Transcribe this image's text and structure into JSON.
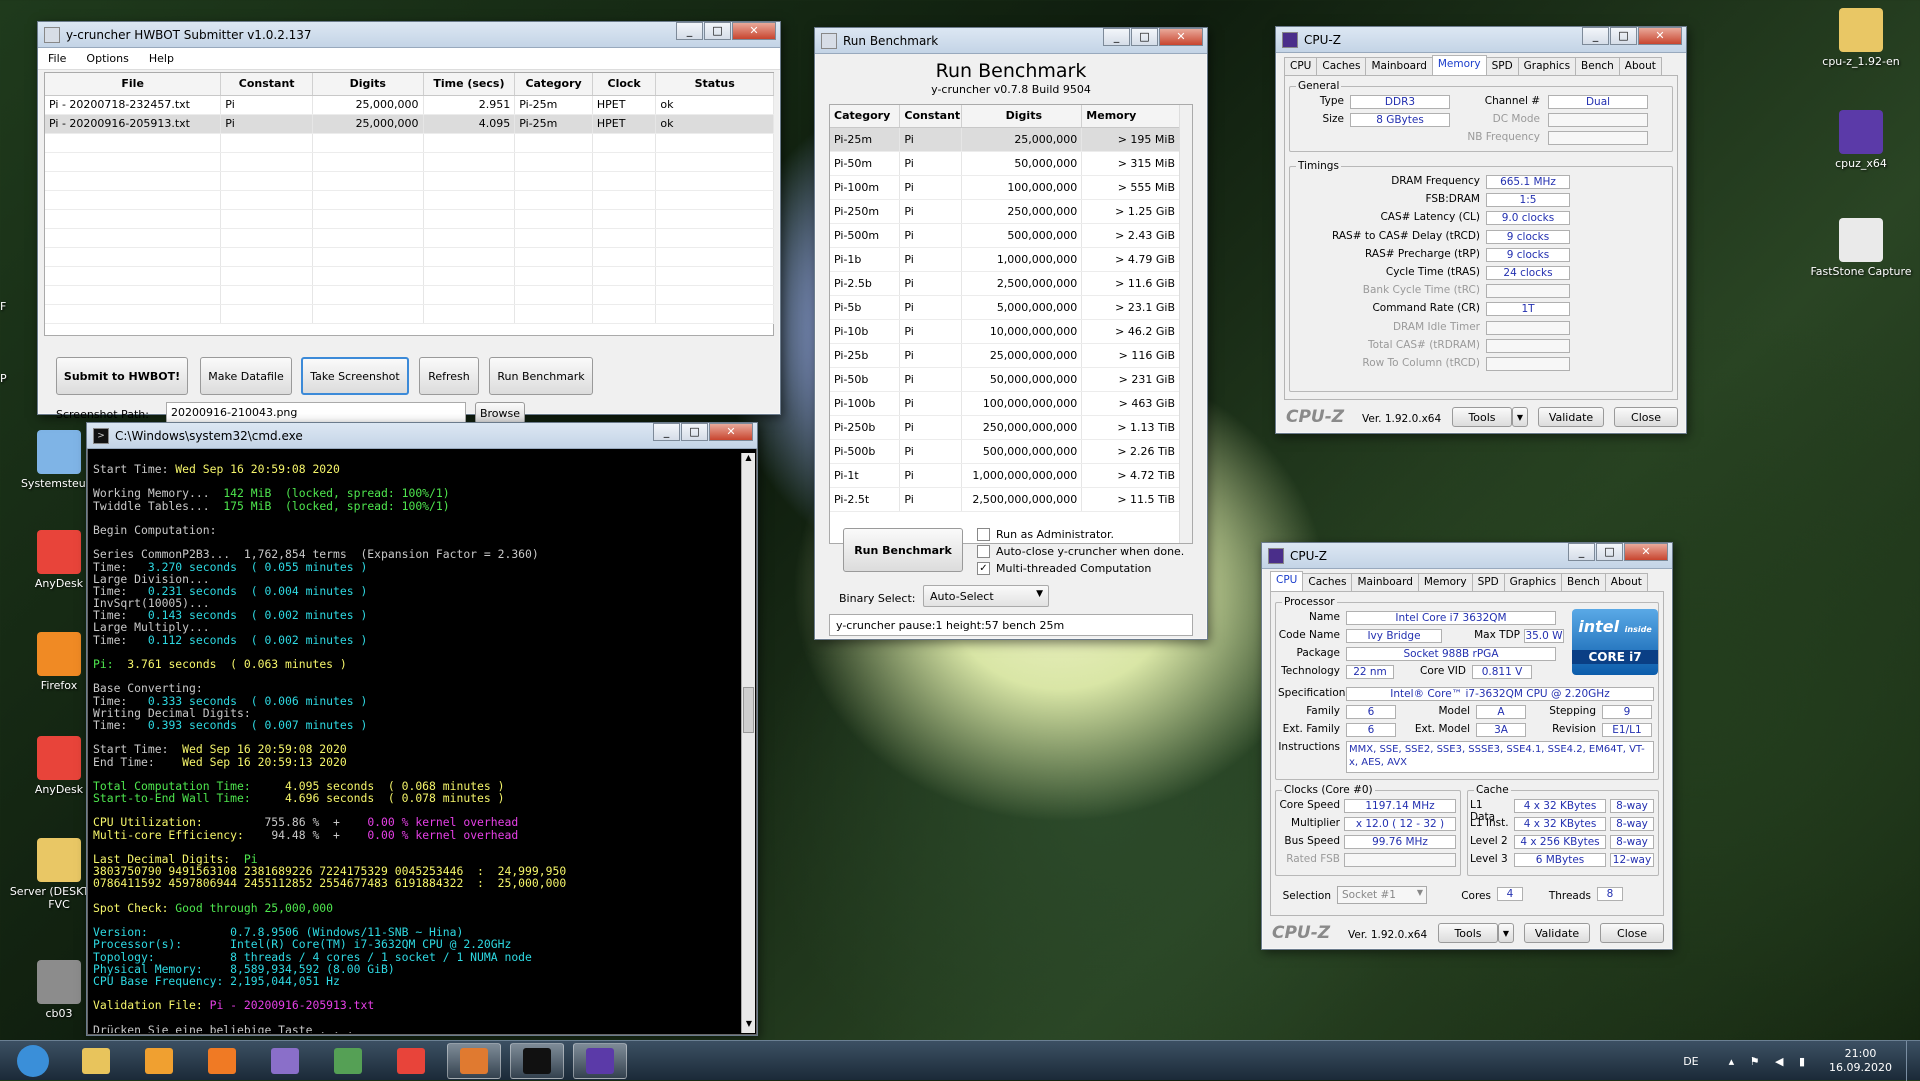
{
  "desktop": {
    "icons_left": [
      {
        "label": "Systemsteuer",
        "icon": "control-panel-icon"
      },
      {
        "label": "AnyDesk",
        "icon": "anydesk-icon"
      },
      {
        "label": "Firefox",
        "icon": "firefox-icon"
      },
      {
        "label": "AnyDesk",
        "icon": "anydesk-icon"
      },
      {
        "label": "Server (DESKTOP-FVC",
        "icon": "server-folder-icon"
      },
      {
        "label": "cb03",
        "icon": "image-file-icon"
      }
    ],
    "icons_right": [
      {
        "label": "cpu-z_1.92-en",
        "icon": "folder-zip-icon"
      },
      {
        "label": "cpuz_x64",
        "icon": "cpuz-icon"
      },
      {
        "label": "FastStone Capture",
        "icon": "faststone-icon"
      }
    ],
    "edge_letters": [
      "F",
      "P"
    ]
  },
  "submitter": {
    "title": "y-cruncher HWBOT Submitter v1.0.2.137",
    "menu": [
      "File",
      "Options",
      "Help"
    ],
    "columns": [
      "File",
      "Constant",
      "Digits",
      "Time (secs)",
      "Category",
      "Clock",
      "Status"
    ],
    "rows": [
      [
        "Pi - 20200718-232457.txt",
        "Pi",
        "25,000,000",
        "2.951",
        "Pi-25m",
        "HPET",
        "ok"
      ],
      [
        "Pi - 20200916-205913.txt",
        "Pi",
        "25,000,000",
        "4.095",
        "Pi-25m",
        "HPET",
        "ok"
      ]
    ],
    "buttons": [
      "Submit to HWBOT!",
      "Make Datafile",
      "Take Screenshot",
      "Refresh",
      "Run Benchmark"
    ],
    "screenshot_label": "Screenshot Path:",
    "screenshot_value": "20200916-210043.png",
    "browse": "Browse"
  },
  "bench": {
    "window_title": "Run Benchmark",
    "heading": "Run Benchmark",
    "subheading": "y-cruncher v0.7.8 Build 9504",
    "columns": [
      "Category",
      "Constant",
      "Digits",
      "Memory"
    ],
    "rows": [
      [
        "Pi-25m",
        "Pi",
        "25,000,000",
        "> 195 MiB"
      ],
      [
        "Pi-50m",
        "Pi",
        "50,000,000",
        "> 315 MiB"
      ],
      [
        "Pi-100m",
        "Pi",
        "100,000,000",
        "> 555 MiB"
      ],
      [
        "Pi-250m",
        "Pi",
        "250,000,000",
        "> 1.25 GiB"
      ],
      [
        "Pi-500m",
        "Pi",
        "500,000,000",
        "> 2.43 GiB"
      ],
      [
        "Pi-1b",
        "Pi",
        "1,000,000,000",
        "> 4.79 GiB"
      ],
      [
        "Pi-2.5b",
        "Pi",
        "2,500,000,000",
        "> 11.6 GiB"
      ],
      [
        "Pi-5b",
        "Pi",
        "5,000,000,000",
        "> 23.1 GiB"
      ],
      [
        "Pi-10b",
        "Pi",
        "10,000,000,000",
        "> 46.2 GiB"
      ],
      [
        "Pi-25b",
        "Pi",
        "25,000,000,000",
        "> 116 GiB"
      ],
      [
        "Pi-50b",
        "Pi",
        "50,000,000,000",
        "> 231 GiB"
      ],
      [
        "Pi-100b",
        "Pi",
        "100,000,000,000",
        "> 463 GiB"
      ],
      [
        "Pi-250b",
        "Pi",
        "250,000,000,000",
        "> 1.13 TiB"
      ],
      [
        "Pi-500b",
        "Pi",
        "500,000,000,000",
        "> 2.26 TiB"
      ],
      [
        "Pi-1t",
        "Pi",
        "1,000,000,000,000",
        "> 4.72 TiB"
      ],
      [
        "Pi-2.5t",
        "Pi",
        "2,500,000,000,000",
        "> 11.5 TiB"
      ]
    ],
    "run_button": "Run Benchmark",
    "checks": [
      {
        "label": "Run as Administrator.",
        "checked": false
      },
      {
        "label": "Auto-close y-cruncher when done.",
        "checked": false
      },
      {
        "label": "Multi-threaded Computation",
        "checked": true
      }
    ],
    "binary_label": "Binary Select:",
    "binary_value": "Auto-Select",
    "command": "y-cruncher pause:1 height:57 bench 25m"
  },
  "cmd": {
    "title": "C:\\Windows\\system32\\cmd.exe",
    "lines": [
      [
        [
          "Start Time: ",
          "cw"
        ],
        [
          "Wed Sep 16 20:59:08 2020",
          "cy"
        ]
      ],
      [
        [
          "",
          ""
        ]
      ],
      [
        [
          "Working Memory...  ",
          "cw"
        ],
        [
          "142 MiB  (locked, spread: 100%/1)",
          "cg"
        ]
      ],
      [
        [
          "Twiddle Tables...  ",
          "cw"
        ],
        [
          "175 MiB  (locked, spread: 100%/1)",
          "cg"
        ]
      ],
      [
        [
          "",
          ""
        ]
      ],
      [
        [
          "Begin Computation:",
          "cw"
        ]
      ],
      [
        [
          "",
          ""
        ]
      ],
      [
        [
          "Series CommonP2B3...  1,762,854 terms  (Expansion Factor = 2.360)",
          "cw"
        ]
      ],
      [
        [
          "Time:   ",
          "cw"
        ],
        [
          "3.270 seconds  ( 0.055 minutes )",
          "cc"
        ]
      ],
      [
        [
          "Large Division...",
          "cw"
        ]
      ],
      [
        [
          "Time:   ",
          "cw"
        ],
        [
          "0.231 seconds  ( 0.004 minutes )",
          "cc"
        ]
      ],
      [
        [
          "InvSqrt(10005)...",
          "cw"
        ]
      ],
      [
        [
          "Time:   ",
          "cw"
        ],
        [
          "0.143 seconds  ( 0.002 minutes )",
          "cc"
        ]
      ],
      [
        [
          "Large Multiply...",
          "cw"
        ]
      ],
      [
        [
          "Time:   ",
          "cw"
        ],
        [
          "0.112 seconds  ( 0.002 minutes )",
          "cc"
        ]
      ],
      [
        [
          "",
          ""
        ]
      ],
      [
        [
          "Pi:  ",
          "cg"
        ],
        [
          "3.761 seconds  ( 0.063 minutes )",
          "cy"
        ]
      ],
      [
        [
          "",
          ""
        ]
      ],
      [
        [
          "Base Converting:",
          "cw"
        ]
      ],
      [
        [
          "Time:   ",
          "cw"
        ],
        [
          "0.333 seconds  ( 0.006 minutes )",
          "cc"
        ]
      ],
      [
        [
          "Writing Decimal Digits:",
          "cw"
        ]
      ],
      [
        [
          "Time:   ",
          "cw"
        ],
        [
          "0.393 seconds  ( 0.007 minutes )",
          "cc"
        ]
      ],
      [
        [
          "",
          ""
        ]
      ],
      [
        [
          "Start Time:  ",
          "cw"
        ],
        [
          "Wed Sep 16 20:59:08 2020",
          "cy"
        ]
      ],
      [
        [
          "End Time:    ",
          "cw"
        ],
        [
          "Wed Sep 16 20:59:13 2020",
          "cy"
        ]
      ],
      [
        [
          "",
          ""
        ]
      ],
      [
        [
          "Total Computation Time:     ",
          "cg"
        ],
        [
          "4.095 seconds  ( 0.068 minutes )",
          "cy"
        ]
      ],
      [
        [
          "Start-to-End Wall Time:     ",
          "cg"
        ],
        [
          "4.696 seconds  ( 0.078 minutes )",
          "cy"
        ]
      ],
      [
        [
          "",
          ""
        ]
      ],
      [
        [
          "CPU Utilization:         ",
          "cy"
        ],
        [
          "755.86 %  +    ",
          "cw"
        ],
        [
          "0.00 % kernel overhead",
          "cm"
        ]
      ],
      [
        [
          "Multi-core Efficiency:    ",
          "cy"
        ],
        [
          "94.48 %  +    ",
          "cw"
        ],
        [
          "0.00 % kernel overhead",
          "cm"
        ]
      ],
      [
        [
          "",
          ""
        ]
      ],
      [
        [
          "Last Decimal Digits:  ",
          "cy"
        ],
        [
          "Pi",
          "cg"
        ]
      ],
      [
        [
          "3803750790 9491563108 2381689226 7224175329 0045253446  :  ",
          "cy"
        ],
        [
          "24,999,950",
          "cy"
        ]
      ],
      [
        [
          "0786411592 4597806944 2455112852 2554677483 6191884322  :  ",
          "cy"
        ],
        [
          "25,000,000",
          "cy"
        ]
      ],
      [
        [
          "",
          ""
        ]
      ],
      [
        [
          "Spot Check: ",
          "cy"
        ],
        [
          "Good through 25,000,000",
          "cg"
        ]
      ],
      [
        [
          "",
          ""
        ]
      ],
      [
        [
          "Version:            0.7.8.9506 (Windows/11-SNB ~ Hina)",
          "cc"
        ]
      ],
      [
        [
          "Processor(s):       Intel(R) Core(TM) i7-3632QM CPU @ 2.20GHz",
          "cc"
        ]
      ],
      [
        [
          "Topology:           8 threads / 4 cores / 1 socket / 1 NUMA node",
          "cc"
        ]
      ],
      [
        [
          "Physical Memory:    8,589,934,592 (8.00 GiB)",
          "cc"
        ]
      ],
      [
        [
          "CPU Base Frequency: 2,195,044,051 Hz",
          "cc"
        ]
      ],
      [
        [
          "",
          ""
        ]
      ],
      [
        [
          "Validation File: ",
          "cy"
        ],
        [
          "Pi - 20200916-205913.txt",
          "cm"
        ]
      ],
      [
        [
          "",
          ""
        ]
      ],
      [
        [
          "Drücken Sie eine beliebige Taste . . .",
          "cw"
        ]
      ]
    ]
  },
  "cpuz_mem": {
    "title": "CPU-Z",
    "tabs": [
      "CPU",
      "Caches",
      "Mainboard",
      "Memory",
      "SPD",
      "Graphics",
      "Bench",
      "About"
    ],
    "active_tab": "Memory",
    "general_label": "General",
    "type_label": "Type",
    "type": "DDR3",
    "size_label": "Size",
    "size": "8 GBytes",
    "channel_label": "Channel #",
    "channel": "Dual",
    "dc_label": "DC Mode",
    "nb_label": "NB Frequency",
    "timings_label": "Timings",
    "timings": [
      {
        "label": "DRAM Frequency",
        "value": "665.1 MHz",
        "dim": false
      },
      {
        "label": "FSB:DRAM",
        "value": "1:5",
        "dim": false
      },
      {
        "label": "CAS# Latency (CL)",
        "value": "9.0 clocks",
        "dim": false
      },
      {
        "label": "RAS# to CAS# Delay (tRCD)",
        "value": "9 clocks",
        "dim": false
      },
      {
        "label": "RAS# Precharge (tRP)",
        "value": "9 clocks",
        "dim": false
      },
      {
        "label": "Cycle Time (tRAS)",
        "value": "24 clocks",
        "dim": false
      },
      {
        "label": "Bank Cycle Time (tRC)",
        "value": "",
        "dim": true
      },
      {
        "label": "Command Rate (CR)",
        "value": "1T",
        "dim": false
      },
      {
        "label": "DRAM Idle Timer",
        "value": "",
        "dim": true
      },
      {
        "label": "Total CAS# (tRDRAM)",
        "value": "",
        "dim": true
      },
      {
        "label": "Row To Column (tRCD)",
        "value": "",
        "dim": true
      }
    ],
    "brand": "CPU-Z",
    "version": "Ver. 1.92.0.x64",
    "tools": "Tools",
    "validate": "Validate",
    "close": "Close"
  },
  "cpuz_cpu": {
    "title": "CPU-Z",
    "tabs": [
      "CPU",
      "Caches",
      "Mainboard",
      "Memory",
      "SPD",
      "Graphics",
      "Bench",
      "About"
    ],
    "active_tab": "CPU",
    "processor_label": "Processor",
    "name_label": "Name",
    "name": "Intel Core i7 3632QM",
    "codename_label": "Code Name",
    "codename": "Ivy Bridge",
    "tdp_label": "Max TDP",
    "tdp": "35.0 W",
    "package_label": "Package",
    "package": "Socket 988B rPGA",
    "tech_label": "Technology",
    "tech": "22 nm",
    "vid_label": "Core VID",
    "vid": "0.811 V",
    "spec_label": "Specification",
    "spec": "Intel® Core™ i7-3632QM CPU @ 2.20GHz",
    "family_label": "Family",
    "family": "6",
    "model_label": "Model",
    "model": "A",
    "stepping_label": "Stepping",
    "stepping": "9",
    "extfam_label": "Ext. Family",
    "extfam": "6",
    "extmodel_label": "Ext. Model",
    "extmodel": "3A",
    "rev_label": "Revision",
    "rev": "E1/L1",
    "instr_label": "Instructions",
    "instr": "MMX, SSE, SSE2, SSE3, SSSE3, SSE4.1, SSE4.2, EM64T, VT-x, AES, AVX",
    "clocks_label": "Clocks (Core #0)",
    "core_speed_label": "Core Speed",
    "core_speed": "1197.14 MHz",
    "multiplier_label": "Multiplier",
    "multiplier": "x 12.0 ( 12 - 32 )",
    "bus_label": "Bus Speed",
    "bus": "99.76 MHz",
    "fsb_label": "Rated FSB",
    "cache_label": "Cache",
    "caches": [
      {
        "label": "L1 Data",
        "size": "4 x 32 KBytes",
        "way": "8-way"
      },
      {
        "label": "L1 Inst.",
        "size": "4 x 32 KBytes",
        "way": "8-way"
      },
      {
        "label": "Level 2",
        "size": "4 x 256 KBytes",
        "way": "8-way"
      },
      {
        "label": "Level 3",
        "size": "6 MBytes",
        "way": "12-way"
      }
    ],
    "selection_label": "Selection",
    "selection": "Socket #1",
    "cores_label": "Cores",
    "cores": "4",
    "threads_label": "Threads",
    "threads": "8",
    "logo_top": "intel",
    "logo_inside": "inside",
    "logo_bottom": "CORE i7",
    "brand": "CPU-Z",
    "version": "Ver. 1.92.0.x64",
    "tools": "Tools",
    "validate": "Validate",
    "close": "Close"
  },
  "taskbar": {
    "apps": [
      "start-orb-icon",
      "explorer-icon",
      "media-player-icon",
      "firefox-icon",
      "winrar-icon",
      "task-manager-icon",
      "anydesk-icon",
      "java-icon",
      "cmd-icon",
      "cpuz-icon"
    ],
    "lang": "DE",
    "time": "21:00",
    "date": "16.09.2020"
  }
}
